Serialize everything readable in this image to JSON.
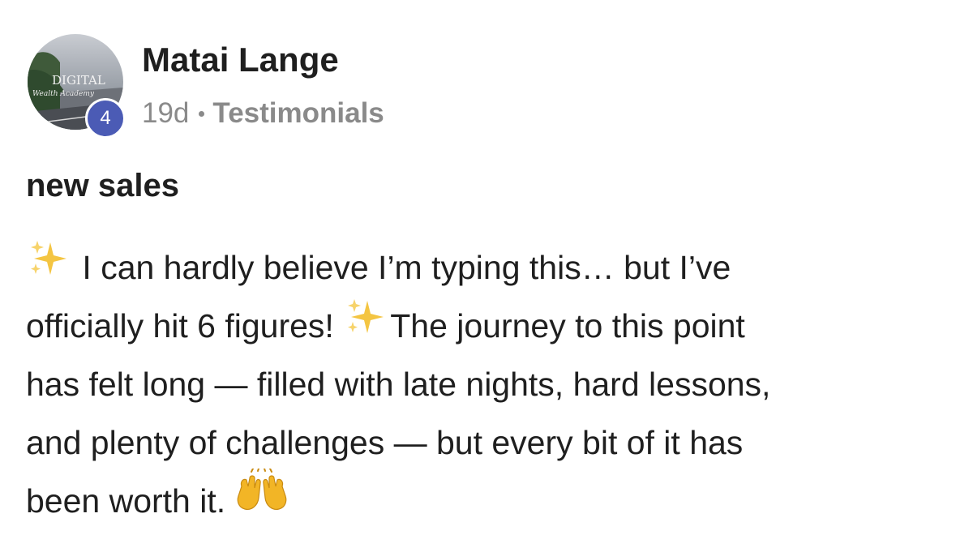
{
  "post": {
    "author": {
      "name": "Matai Lange",
      "avatar_text": "DIGITAL",
      "avatar_subtext": "Wealth Academy",
      "level": "4"
    },
    "time_ago": "19d",
    "category": "Testimonials",
    "title": "new sales",
    "body": {
      "line1_text": "I can hardly believe I’m typing this… but I’ve",
      "line2_text_a": "officially hit 6 figures!",
      "line2_text_b": "The journey to this point",
      "line3_text": "has felt long — filled with late nights, hard lessons,",
      "line4_text": "and plenty of challenges — but every bit of it has",
      "line5_text": "been worth it."
    },
    "icons": {
      "sparkles": "sparkles-emoji",
      "raising_hands": "raising-hands-emoji"
    },
    "colors": {
      "level_badge": "#4b5bb5",
      "meta_text": "#8a8a8a"
    }
  }
}
